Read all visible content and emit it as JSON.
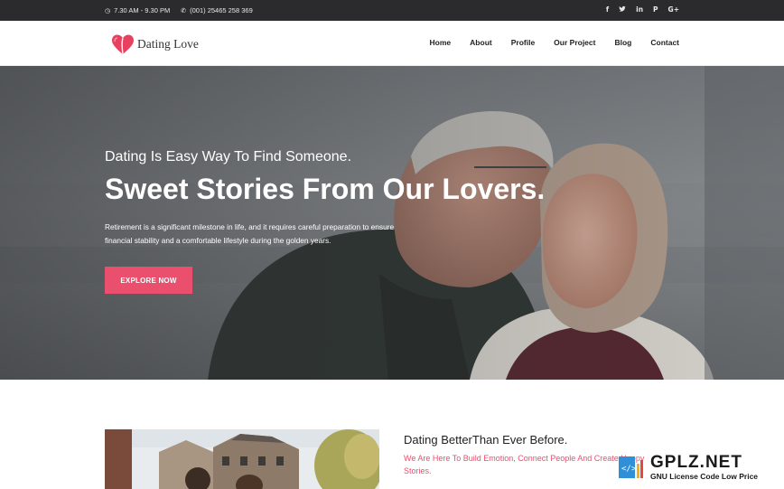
{
  "topbar": {
    "hours": "7.30 AM - 9.30 PM",
    "phone": "(001) 25465 258 369",
    "social": [
      {
        "icon": "facebook-icon",
        "glyph": "f"
      },
      {
        "icon": "twitter-icon",
        "glyph": "🐦"
      },
      {
        "icon": "linkedin-icon",
        "glyph": "in"
      },
      {
        "icon": "pinterest-icon",
        "glyph": "P"
      },
      {
        "icon": "google-plus-icon",
        "glyph": "G+"
      }
    ]
  },
  "brand": {
    "name": "Dating Love",
    "accent_color": "#ea4f6e"
  },
  "nav": {
    "items": [
      "Home",
      "About",
      "Profile",
      "Our Project",
      "Blog",
      "Contact"
    ]
  },
  "hero": {
    "subtitle": "Dating Is Easy Way To Find Someone.",
    "title": "Sweet Stories From Our Lovers.",
    "description": "Retirement is a significant milestone in life, and it requires careful preparation to ensure financial stability and a comfortable lifestyle during the golden years.",
    "button_label": "EXPLORE NOW"
  },
  "about": {
    "title": "Dating BetterThan Ever Before.",
    "subtitle": "We Are Here To Build Emotion, Connect People And Create Happy Stories."
  },
  "watermark": {
    "name": "GPLZ.NET",
    "tagline": "GNU License Code Low Price"
  }
}
